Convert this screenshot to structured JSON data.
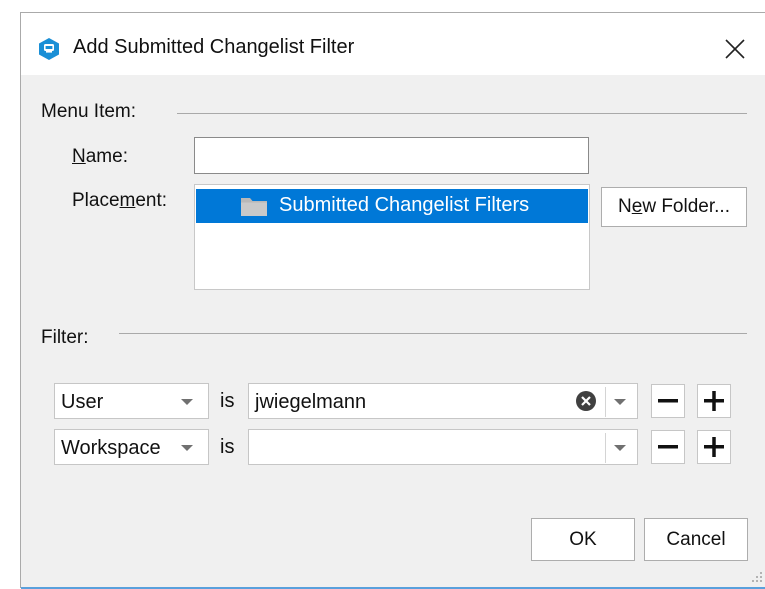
{
  "window": {
    "title": "Add Submitted Changelist Filter",
    "icon": "p4v-app-icon",
    "close_icon": "close-icon"
  },
  "menu_item": {
    "section_label": "Menu Item:",
    "name_label_prefix": "",
    "name_label_mnemonic": "N",
    "name_label_rest": "ame:",
    "name_value": "",
    "placement_label_prefix": "Place",
    "placement_label_mnemonic": "m",
    "placement_label_rest": "ent:",
    "placement_items": [
      {
        "label": "Submitted Changelist Filters",
        "icon": "folder-icon",
        "selected": true
      }
    ],
    "new_folder_prefix": "N",
    "new_folder_mnemonic": "e",
    "new_folder_rest": "w Folder..."
  },
  "filter": {
    "section_label": "Filter:",
    "rows": [
      {
        "field": "User",
        "operator": "is",
        "value": "jwiegelmann",
        "has_clear": true
      },
      {
        "field": "Workspace",
        "operator": "is",
        "value": "",
        "has_clear": false
      }
    ],
    "remove_icon": "minus-icon",
    "add_icon": "plus-icon"
  },
  "buttons": {
    "ok": "OK",
    "cancel": "Cancel"
  },
  "colors": {
    "selection": "#0078d7",
    "dialog_bg": "#f0f0f0",
    "accent_line": "#5aa0dc"
  }
}
